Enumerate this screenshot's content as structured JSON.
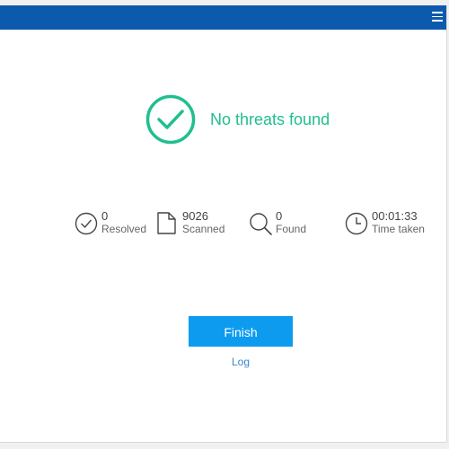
{
  "header": {
    "menu_icon": "hamburger-menu-icon",
    "bar_color": "#0b5aad"
  },
  "result": {
    "icon": "check-circle-icon",
    "title": "No threats found",
    "color": "#1fbf8f"
  },
  "stats": {
    "resolved": {
      "value": "0",
      "label": "Resolved",
      "icon": "check-circle-icon"
    },
    "scanned": {
      "value": "9026",
      "label": "Scanned",
      "icon": "document-icon"
    },
    "found": {
      "value": "0",
      "label": "Found",
      "icon": "magnifier-icon"
    },
    "time": {
      "value": "00:01:33",
      "label": "Time taken",
      "icon": "clock-icon"
    }
  },
  "actions": {
    "finish_label": "Finish",
    "finish_color": "#0d9bf0",
    "log_label": "Log"
  }
}
